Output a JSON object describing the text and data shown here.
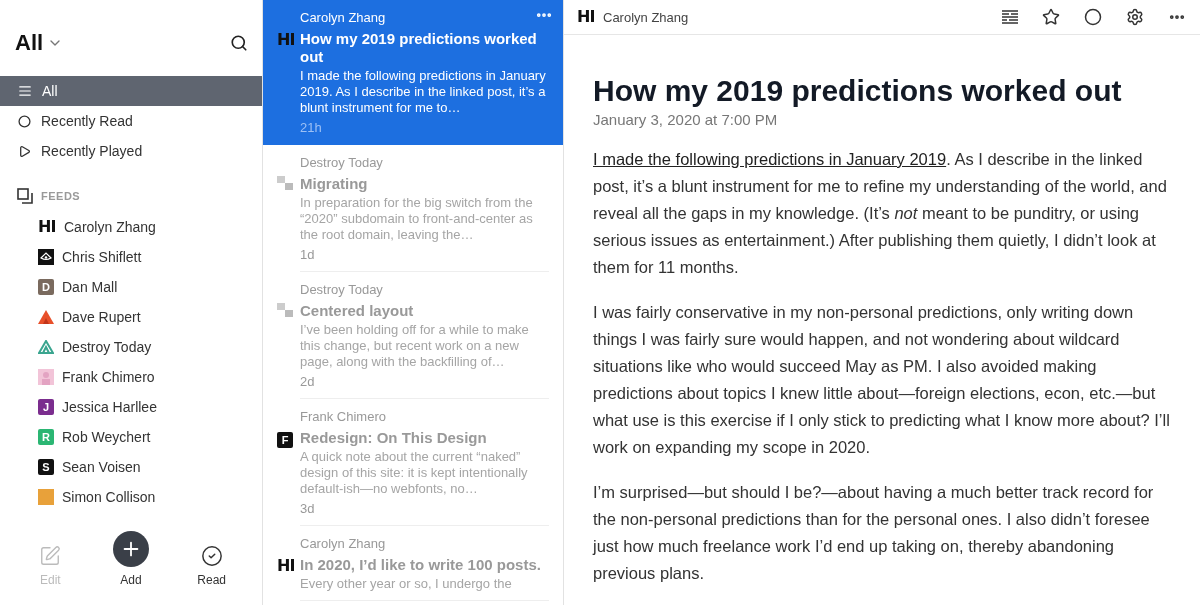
{
  "sidebar": {
    "title": "All",
    "nav": [
      {
        "label": "All",
        "selected": true
      },
      {
        "label": "Recently Read",
        "selected": false
      },
      {
        "label": "Recently Played",
        "selected": false
      }
    ],
    "feeds_heading": "FEEDS",
    "feeds": [
      {
        "name": "Carolyn Zhang",
        "icon": {
          "kind": "letters",
          "text": "HI",
          "color": "#111111"
        }
      },
      {
        "name": "Chris Shiflett",
        "icon": {
          "kind": "eye",
          "color": "#111111"
        }
      },
      {
        "name": "Dan Mall",
        "icon": {
          "kind": "letter",
          "text": "D",
          "color": "#7a6a5e"
        }
      },
      {
        "name": "Dave Rupert",
        "icon": {
          "kind": "peak",
          "color": "#e8502a"
        }
      },
      {
        "name": "Destroy Today",
        "icon": {
          "kind": "triangle",
          "color": "#3aa58f"
        }
      },
      {
        "name": "Frank Chimero",
        "icon": {
          "kind": "portrait",
          "color": "#f2c4d8"
        }
      },
      {
        "name": "Jessica Harllee",
        "icon": {
          "kind": "letter",
          "text": "J",
          "color": "#7b2d8e"
        }
      },
      {
        "name": "Rob Weychert",
        "icon": {
          "kind": "letter",
          "text": "R",
          "color": "#2bb673"
        }
      },
      {
        "name": "Sean Voisen",
        "icon": {
          "kind": "letter",
          "text": "S",
          "color": "#111111"
        }
      },
      {
        "name": "Simon Collison",
        "icon": {
          "kind": "square",
          "color": "#e8a13a"
        }
      }
    ],
    "actions": [
      {
        "label": "Edit",
        "disabled": true
      },
      {
        "label": "Add",
        "disabled": false
      },
      {
        "label": "Read",
        "disabled": false
      }
    ]
  },
  "articles": [
    {
      "source": "Carolyn Zhang",
      "icon": {
        "kind": "letters",
        "text": "HI"
      },
      "title": "How my 2019 predictions worked out",
      "excerpt": "I made the following predictions in January 2019. As I describe in the linked post, it’s a blunt instrument for me to…",
      "age": "21h",
      "selected": true
    },
    {
      "source": "Destroy Today",
      "icon": {
        "kind": "pixels"
      },
      "title": "Migrating",
      "excerpt": "In preparation for the big switch from the “2020” subdomain to front-and-center as the root domain, leaving the…",
      "age": "1d",
      "selected": false
    },
    {
      "source": "Destroy Today",
      "icon": {
        "kind": "pixels"
      },
      "title": "Centered layout",
      "excerpt": "I’ve been holding off for a while to make this change, but recent work on a new page, along with the backfilling of…",
      "age": "2d",
      "selected": false
    },
    {
      "source": "Frank Chimero",
      "icon": {
        "kind": "letter",
        "text": "F"
      },
      "title": "Redesign: On This Design",
      "excerpt": "A quick note about the current “naked” design of this site: it is kept intentionally default-ish—no webfonts, no…",
      "age": "3d",
      "selected": false
    },
    {
      "source": "Carolyn Zhang",
      "icon": {
        "kind": "letters",
        "text": "HI"
      },
      "title": "In 2020, I’d like to write 100 posts.",
      "excerpt": "Every other year or so, I undergo the",
      "selected": false
    }
  ],
  "reader": {
    "feed_logo": "HI",
    "feed_name": "Carolyn Zhang",
    "title": "How my 2019 predictions worked out",
    "date": "January 3, 2020 at 7:00 PM",
    "paragraphs": [
      {
        "link": "I made the following predictions in January 2019",
        "text": ". As I describe in the linked post, it’s a blunt instrument for me to refine my understanding of the world, and reveal all the gaps in my knowledge. (It’s *not* meant to be punditry, or using serious issues as entertainment.) After publishing them quietly, I didn’t look at them for 11 months."
      },
      {
        "text": "I was fairly conservative in my non-personal predictions, only writing down things I was fairly sure would happen, and not wondering about wildcard situations like who would succeed May as PM. I also avoided making predictions about topics I knew little about—foreign elections, econ, etc.—but what use is this exercise if I only stick to predicting what I know more about? I’ll work on expanding my scope in 2020."
      },
      {
        "text": "I’m surprised—but should I be?—about having a much better track record for the non-personal predictions than for the personal ones. I also didn’t foresee just how much freelance work I’d end up taking on, thereby abandoning previous plans."
      }
    ]
  }
}
